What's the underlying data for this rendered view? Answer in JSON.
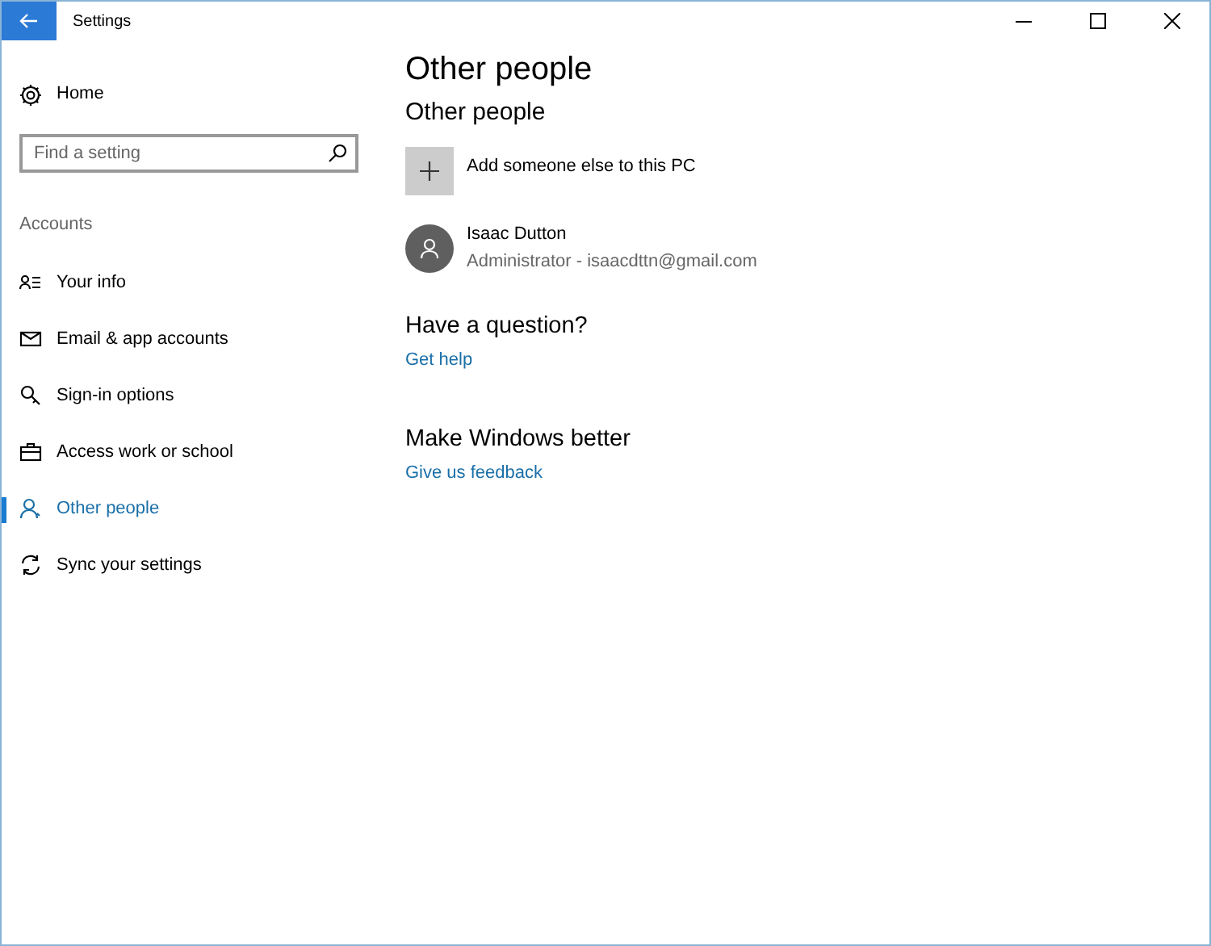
{
  "window": {
    "title": "Settings"
  },
  "sidebar": {
    "home": "Home",
    "search": {
      "placeholder": "Find a setting"
    },
    "section": "Accounts",
    "items": [
      {
        "label": "Your info",
        "selected": false
      },
      {
        "label": "Email & app accounts",
        "selected": false
      },
      {
        "label": "Sign-in options",
        "selected": false
      },
      {
        "label": "Access work or school",
        "selected": false
      },
      {
        "label": "Other people",
        "selected": true
      },
      {
        "label": "Sync your settings",
        "selected": false
      }
    ]
  },
  "main": {
    "title": "Other people",
    "subtitle": "Other people",
    "add_label": "Add someone else to this PC",
    "user": {
      "name": "Isaac Dutton",
      "detail": "Administrator - isaacdttn@gmail.com"
    },
    "help": {
      "heading": "Have a question?",
      "link": "Get help"
    },
    "feedback": {
      "heading": "Make Windows better",
      "link": "Give us feedback"
    }
  }
}
